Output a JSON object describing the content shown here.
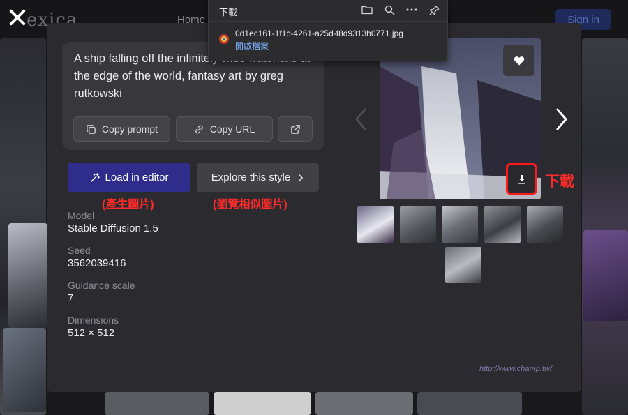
{
  "background_page": {
    "logo": "exica",
    "nav_home": "Home",
    "sign_in": "Sign in"
  },
  "prompt": {
    "text": "A ship falling off the infinitely wide waterfalls at the edge of the world, fantasy art by greg rutkowski",
    "copy_prompt_label": "Copy prompt",
    "copy_url_label": "Copy URL"
  },
  "actions": {
    "load_in_editor": "Load in editor",
    "explore_style": "Explore this style"
  },
  "annotations": {
    "load_editor": "(產生圖片)",
    "explore_style": "(瀏覽相似圖片)",
    "download": "下載"
  },
  "metadata": {
    "model_label": "Model",
    "model_value": "Stable Diffusion 1.5",
    "seed_label": "Seed",
    "seed_value": "3562039416",
    "guidance_label": "Guidance scale",
    "guidance_value": "7",
    "dimensions_label": "Dimensions",
    "dimensions_value": "512 × 512"
  },
  "download_panel": {
    "title": "下載",
    "file_name": "0d1ec161-1f1c-4261-a25d-f8d9313b0771.jpg",
    "open_file": "開啟檔案"
  },
  "watermark": "http://www.champ.tw/",
  "colors": {
    "accent_primary": "#2f2d8c",
    "annotation_red": "#ff1a1a",
    "link_blue": "#7db3ff"
  },
  "icons": [
    "close-icon",
    "copy-icon",
    "link-icon",
    "external-link-icon",
    "magic-wand-icon",
    "chevron-right-icon",
    "heart-icon",
    "download-icon",
    "chevron-left-icon",
    "folder-icon",
    "search-icon",
    "more-icon",
    "pin-icon",
    "file-icon"
  ]
}
